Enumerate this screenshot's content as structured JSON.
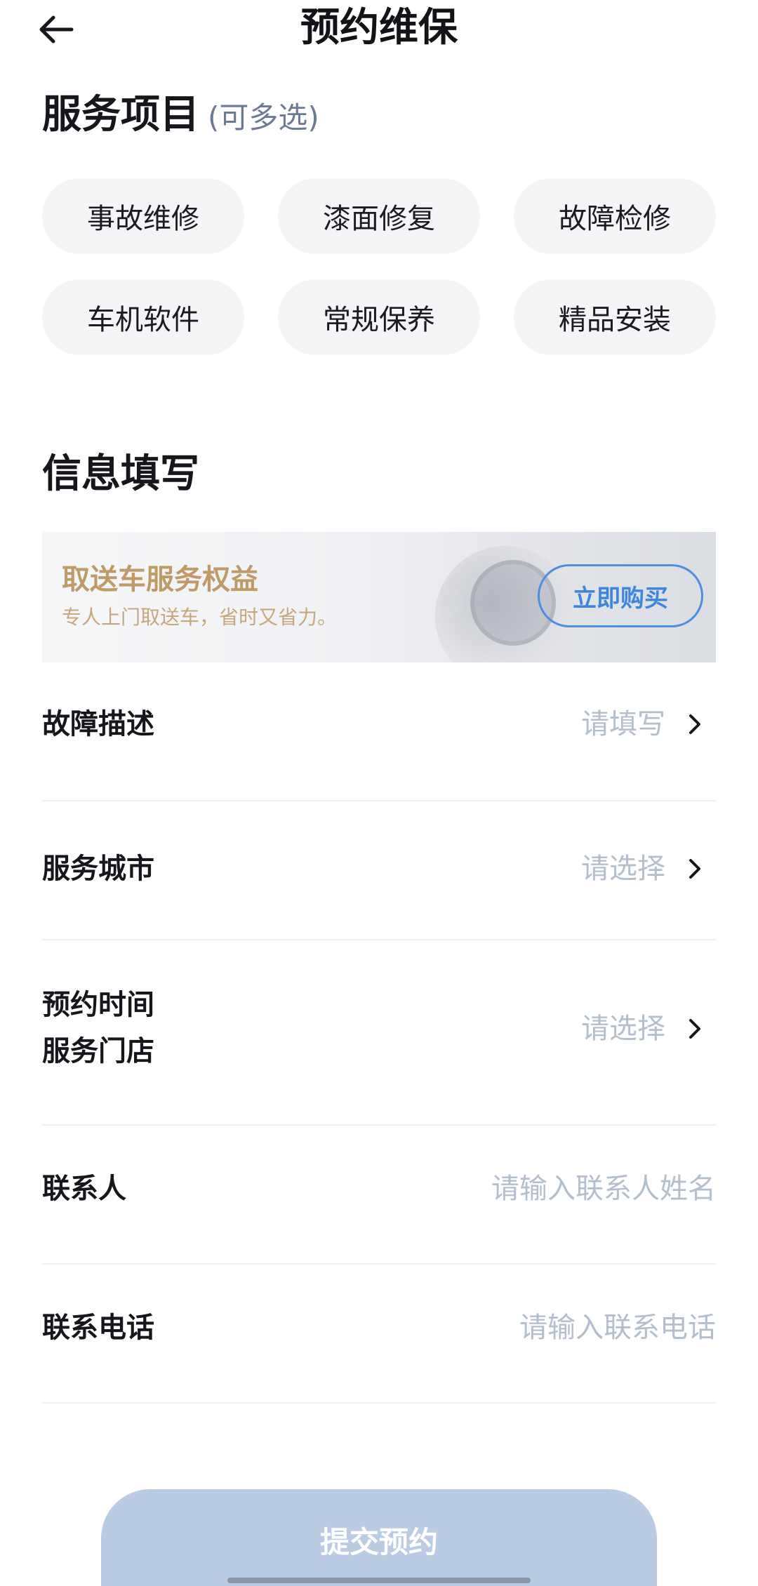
{
  "header": {
    "title": "预约维保"
  },
  "services": {
    "title": "服务项目",
    "subtitle": "(可多选)",
    "items": [
      "事故维修",
      "漆面修复",
      "故障检修",
      "车机软件",
      "常规保养",
      "精品安装"
    ]
  },
  "info": {
    "title": "信息填写"
  },
  "banner": {
    "title": "取送车服务权益",
    "desc": "专人上门取送车，省时又省力。",
    "button": "立即购买"
  },
  "form": {
    "fault": {
      "label": "故障描述",
      "value": "请填写"
    },
    "city": {
      "label": "服务城市",
      "value": "请选择"
    },
    "time": {
      "label1": "预约时间",
      "label2": "服务门店",
      "value": "请选择"
    },
    "contact": {
      "label": "联系人",
      "placeholder": "请输入联系人姓名"
    },
    "phone": {
      "label": "联系电话",
      "placeholder": "请输入联系电话"
    }
  },
  "submit": {
    "label": "提交预约"
  },
  "colors": {
    "accent_blue": "#3d86dd",
    "gold": "#c09a67",
    "placeholder": "#b4bfcd",
    "submit_disabled": "#b9cce3"
  }
}
